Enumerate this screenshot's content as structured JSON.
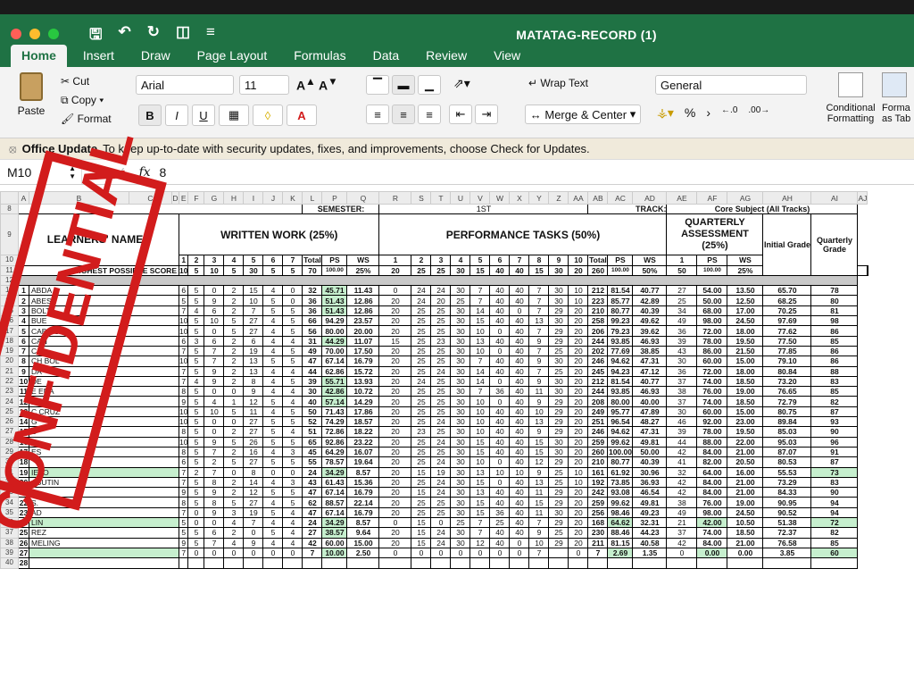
{
  "window": {
    "title": "MATATAG-RECORD (1)"
  },
  "tabs": [
    "Home",
    "Insert",
    "Draw",
    "Page Layout",
    "Formulas",
    "Data",
    "Review",
    "View"
  ],
  "ribbon": {
    "paste": "Paste",
    "cut": "Cut",
    "copy": "Copy",
    "format": "Format",
    "font": "Arial",
    "size": "11",
    "wrap": "Wrap Text",
    "merge": "Merge & Center",
    "numfmt": "General",
    "percent": "%",
    "cond1": "Conditional",
    "cond2": "Formatting",
    "fmt1": "Forma",
    "fmt2": "as Tab"
  },
  "notice": {
    "title": "Office Update",
    "text": "To keep up-to-date with security updates, fixes, and improvements, choose Check for Updates."
  },
  "formula": {
    "cell": "M10",
    "fx": "fx",
    "value": "8"
  },
  "stamp": "CONFIDENTIAL",
  "cols": [
    "A",
    "B",
    "C",
    "D",
    "E",
    "F",
    "G",
    "H",
    "I",
    "J",
    "K",
    "L",
    "P",
    "Q",
    "R",
    "S",
    "T",
    "U",
    "V",
    "W",
    "X",
    "Y",
    "Z",
    "AA",
    "AB",
    "AC",
    "AD",
    "AE",
    "AF",
    "AG",
    "AH",
    "AI",
    "AJ"
  ],
  "header": {
    "semester_label": "SEMESTER:",
    "semester": "1ST",
    "track_label": "TRACK:",
    "track": "Core Subject (All Tracks)",
    "names": "LEARNERS' NAMES",
    "ww": "WRITTEN WORK (25%)",
    "pt": "PERFORMANCE TASKS (50%)",
    "qa": "QUARTERLY ASSESSMENT (25%)",
    "initial": "Initial Grade",
    "quarterly": "Quarterly Grade",
    "hps": "HIGHEST POSSIBLE SCORE",
    "total": "Total",
    "ps": "PS",
    "ws": "WS"
  },
  "hps": {
    "ww": [
      "10",
      "5",
      "10",
      "5",
      "30",
      "5",
      "5",
      "70",
      "100.00",
      "25%"
    ],
    "pt": [
      "20",
      "25",
      "25",
      "30",
      "15",
      "40",
      "40",
      "15",
      "30",
      "20",
      "260",
      "100.00",
      "50%"
    ],
    "qa": [
      "50",
      "100.00",
      "25%"
    ]
  },
  "rows": [
    {
      "r": "13",
      "n": "1",
      "name": "ABDA",
      "ww": [
        "6",
        "5",
        "0",
        "2",
        "15",
        "4",
        "0",
        "32",
        "45.71",
        "11.43"
      ],
      "pt": [
        "0",
        "24",
        "24",
        "30",
        "7",
        "40",
        "40",
        "7",
        "30",
        "10",
        "212",
        "81.54",
        "40.77"
      ],
      "qa": [
        "27",
        "54.00",
        "13.50"
      ],
      "ig": "65.70",
      "qg": "78",
      "psg": 1
    },
    {
      "r": "14",
      "n": "2",
      "name": "ABES",
      "ww": [
        "5",
        "5",
        "9",
        "2",
        "10",
        "5",
        "0",
        "36",
        "51.43",
        "12.86"
      ],
      "pt": [
        "20",
        "24",
        "20",
        "25",
        "7",
        "40",
        "40",
        "7",
        "30",
        "10",
        "223",
        "85.77",
        "42.89"
      ],
      "qa": [
        "25",
        "50.00",
        "12.50"
      ],
      "ig": "68.25",
      "qg": "80",
      "psg": 1
    },
    {
      "r": "15",
      "n": "3",
      "name": "BOLT",
      "ww": [
        "7",
        "4",
        "6",
        "2",
        "7",
        "5",
        "5",
        "36",
        "51.43",
        "12.86"
      ],
      "pt": [
        "20",
        "25",
        "25",
        "30",
        "14",
        "40",
        "0",
        "7",
        "29",
        "20",
        "210",
        "80.77",
        "40.39"
      ],
      "qa": [
        "34",
        "68.00",
        "17.00"
      ],
      "ig": "70.25",
      "qg": "81",
      "psg": 1
    },
    {
      "r": "16",
      "n": "4",
      "name": "BUE",
      "ww": [
        "10",
        "5",
        "10",
        "5",
        "27",
        "4",
        "5",
        "66",
        "94.29",
        "23.57"
      ],
      "pt": [
        "20",
        "25",
        "25",
        "30",
        "15",
        "40",
        "40",
        "13",
        "30",
        "20",
        "258",
        "99.23",
        "49.62"
      ],
      "qa": [
        "49",
        "98.00",
        "24.50"
      ],
      "ig": "97.69",
      "qg": "98"
    },
    {
      "r": "17",
      "n": "5",
      "name": "CAB ES",
      "ww": [
        "10",
        "5",
        "0",
        "5",
        "27",
        "4",
        "5",
        "56",
        "80.00",
        "20.00"
      ],
      "pt": [
        "20",
        "25",
        "25",
        "30",
        "10",
        "0",
        "40",
        "7",
        "29",
        "20",
        "206",
        "79.23",
        "39.62"
      ],
      "qa": [
        "36",
        "72.00",
        "18.00"
      ],
      "ig": "77.62",
      "qg": "86"
    },
    {
      "r": "18",
      "n": "6",
      "name": "CAN",
      "ww": [
        "6",
        "3",
        "6",
        "2",
        "6",
        "4",
        "4",
        "31",
        "44.29",
        "11.07"
      ],
      "pt": [
        "15",
        "25",
        "23",
        "30",
        "13",
        "40",
        "40",
        "9",
        "29",
        "20",
        "244",
        "93.85",
        "46.93"
      ],
      "qa": [
        "39",
        "78.00",
        "19.50"
      ],
      "ig": "77.50",
      "qg": "85",
      "psg": 1
    },
    {
      "r": "19",
      "n": "7",
      "name": "CA",
      "ww": [
        "7",
        "5",
        "7",
        "2",
        "19",
        "4",
        "5",
        "49",
        "70.00",
        "17.50"
      ],
      "pt": [
        "20",
        "25",
        "25",
        "30",
        "10",
        "0",
        "40",
        "7",
        "25",
        "20",
        "202",
        "77.69",
        "38.85"
      ],
      "qa": [
        "43",
        "86.00",
        "21.50"
      ],
      "ig": "77.85",
      "qg": "86"
    },
    {
      "r": "20",
      "n": "8",
      "name": "CH BOL",
      "ww": [
        "10",
        "5",
        "7",
        "2",
        "13",
        "5",
        "5",
        "47",
        "67.14",
        "16.79"
      ],
      "pt": [
        "20",
        "25",
        "25",
        "30",
        "7",
        "40",
        "40",
        "9",
        "30",
        "20",
        "246",
        "94.62",
        "47.31"
      ],
      "qa": [
        "30",
        "60.00",
        "15.00"
      ],
      "ig": "79.10",
      "qg": "86"
    },
    {
      "r": "21",
      "n": "9",
      "name": "DA",
      "ww": [
        "7",
        "5",
        "9",
        "2",
        "13",
        "4",
        "4",
        "44",
        "62.86",
        "15.72"
      ],
      "pt": [
        "20",
        "25",
        "24",
        "30",
        "14",
        "40",
        "40",
        "7",
        "25",
        "20",
        "245",
        "94.23",
        "47.12"
      ],
      "qa": [
        "36",
        "72.00",
        "18.00"
      ],
      "ig": "80.84",
      "qg": "88"
    },
    {
      "r": "22",
      "n": "10",
      "name": "DE",
      "ww": [
        "7",
        "4",
        "9",
        "2",
        "8",
        "4",
        "5",
        "39",
        "55.71",
        "13.93"
      ],
      "pt": [
        "20",
        "24",
        "25",
        "30",
        "14",
        "0",
        "40",
        "9",
        "30",
        "20",
        "212",
        "81.54",
        "40.77"
      ],
      "qa": [
        "37",
        "74.00",
        "18.50"
      ],
      "ig": "73.20",
      "qg": "83",
      "psg": 1
    },
    {
      "r": "23",
      "n": "11",
      "name": "E ENA",
      "ww": [
        "8",
        "5",
        "0",
        "0",
        "9",
        "4",
        "4",
        "30",
        "42.86",
        "10.72"
      ],
      "pt": [
        "20",
        "25",
        "25",
        "30",
        "7",
        "36",
        "40",
        "11",
        "30",
        "20",
        "244",
        "93.85",
        "46.93"
      ],
      "qa": [
        "38",
        "76.00",
        "19.00"
      ],
      "ig": "76.65",
      "qg": "85",
      "psg": 1
    },
    {
      "r": "24",
      "n": "12",
      "name": "F",
      "ww": [
        "9",
        "5",
        "4",
        "1",
        "12",
        "5",
        "4",
        "40",
        "57.14",
        "14.29"
      ],
      "pt": [
        "20",
        "25",
        "25",
        "30",
        "10",
        "0",
        "40",
        "9",
        "29",
        "20",
        "208",
        "80.00",
        "40.00"
      ],
      "qa": [
        "37",
        "74.00",
        "18.50"
      ],
      "ig": "72.79",
      "qg": "82",
      "psg": 1
    },
    {
      "r": "25",
      "n": "13",
      "name": "C CRUZ",
      "ww": [
        "10",
        "5",
        "10",
        "5",
        "11",
        "4",
        "5",
        "50",
        "71.43",
        "17.86"
      ],
      "pt": [
        "20",
        "25",
        "25",
        "30",
        "10",
        "40",
        "40",
        "10",
        "29",
        "20",
        "249",
        "95.77",
        "47.89"
      ],
      "qa": [
        "30",
        "60.00",
        "15.00"
      ],
      "ig": "80.75",
      "qg": "87"
    },
    {
      "r": "26",
      "n": "14",
      "name": "G",
      "ww": [
        "10",
        "5",
        "0",
        "0",
        "27",
        "5",
        "5",
        "52",
        "74.29",
        "18.57"
      ],
      "pt": [
        "20",
        "25",
        "24",
        "30",
        "10",
        "40",
        "40",
        "13",
        "29",
        "20",
        "251",
        "96.54",
        "48.27"
      ],
      "qa": [
        "46",
        "92.00",
        "23.00"
      ],
      "ig": "89.84",
      "qg": "93"
    },
    {
      "r": "27",
      "n": "15",
      "name": "C",
      "ww": [
        "8",
        "5",
        "0",
        "2",
        "27",
        "5",
        "4",
        "51",
        "72.86",
        "18.22"
      ],
      "pt": [
        "20",
        "23",
        "25",
        "30",
        "10",
        "40",
        "40",
        "9",
        "29",
        "20",
        "246",
        "94.62",
        "47.31"
      ],
      "qa": [
        "39",
        "78.00",
        "19.50"
      ],
      "ig": "85.03",
      "qg": "90"
    },
    {
      "r": "28",
      "n": "16",
      "name": "",
      "ww": [
        "10",
        "5",
        "9",
        "5",
        "26",
        "5",
        "5",
        "65",
        "92.86",
        "23.22"
      ],
      "pt": [
        "20",
        "25",
        "24",
        "30",
        "15",
        "40",
        "40",
        "15",
        "30",
        "20",
        "259",
        "99.62",
        "49.81"
      ],
      "qa": [
        "44",
        "88.00",
        "22.00"
      ],
      "ig": "95.03",
      "qg": "96"
    },
    {
      "r": "29",
      "n": "17",
      "name": "ES",
      "ww": [
        "8",
        "5",
        "7",
        "2",
        "16",
        "4",
        "3",
        "45",
        "64.29",
        "16.07"
      ],
      "pt": [
        "20",
        "25",
        "25",
        "30",
        "15",
        "40",
        "40",
        "15",
        "30",
        "20",
        "260",
        "100.00",
        "50.00"
      ],
      "qa": [
        "42",
        "84.00",
        "21.00"
      ],
      "ig": "87.07",
      "qg": "91"
    },
    {
      "r": "30",
      "n": "18",
      "name": "",
      "ww": [
        "6",
        "5",
        "2",
        "5",
        "27",
        "5",
        "5",
        "55",
        "78.57",
        "19.64"
      ],
      "pt": [
        "20",
        "25",
        "24",
        "30",
        "10",
        "0",
        "40",
        "12",
        "29",
        "20",
        "210",
        "80.77",
        "40.39"
      ],
      "qa": [
        "41",
        "82.00",
        "20.50"
      ],
      "ig": "80.53",
      "qg": "87"
    },
    {
      "r": "31",
      "n": "19",
      "name": "IETO",
      "ww": [
        "7",
        "2",
        "7",
        "0",
        "8",
        "0",
        "0",
        "24",
        "34.29",
        "8.57"
      ],
      "pt": [
        "20",
        "15",
        "19",
        "30",
        "13",
        "10",
        "10",
        "9",
        "25",
        "10",
        "161",
        "61.92",
        "30.96"
      ],
      "qa": [
        "32",
        "64.00",
        "16.00"
      ],
      "ig": "55.53",
      "qg": "73",
      "hl": 1,
      "psg": 1
    },
    {
      "r": "32",
      "n": "20",
      "name": "ABUTIN",
      "ww": [
        "7",
        "5",
        "8",
        "2",
        "14",
        "4",
        "3",
        "43",
        "61.43",
        "15.36"
      ],
      "pt": [
        "20",
        "25",
        "24",
        "30",
        "15",
        "0",
        "40",
        "13",
        "25",
        "10",
        "192",
        "73.85",
        "36.93"
      ],
      "qa": [
        "42",
        "84.00",
        "21.00"
      ],
      "ig": "73.29",
      "qg": "83"
    },
    {
      "r": "33",
      "n": "21",
      "name": "",
      "ww": [
        "9",
        "5",
        "9",
        "2",
        "12",
        "5",
        "5",
        "47",
        "67.14",
        "16.79"
      ],
      "pt": [
        "20",
        "15",
        "24",
        "30",
        "13",
        "40",
        "40",
        "11",
        "29",
        "20",
        "242",
        "93.08",
        "46.54"
      ],
      "qa": [
        "42",
        "84.00",
        "21.00"
      ],
      "ig": "84.33",
      "qg": "90"
    },
    {
      "r": "34",
      "n": "22",
      "name": "S.",
      "ww": [
        "8",
        "5",
        "8",
        "5",
        "27",
        "4",
        "5",
        "62",
        "88.57",
        "22.14"
      ],
      "pt": [
        "20",
        "25",
        "25",
        "30",
        "15",
        "40",
        "40",
        "15",
        "29",
        "20",
        "259",
        "99.62",
        "49.81"
      ],
      "qa": [
        "38",
        "76.00",
        "19.00"
      ],
      "ig": "90.95",
      "qg": "94"
    },
    {
      "r": "35",
      "n": "23",
      "name": "AD",
      "ww": [
        "7",
        "0",
        "9",
        "3",
        "19",
        "5",
        "4",
        "47",
        "67.14",
        "16.79"
      ],
      "pt": [
        "20",
        "25",
        "25",
        "30",
        "15",
        "36",
        "40",
        "11",
        "30",
        "20",
        "256",
        "98.46",
        "49.23"
      ],
      "qa": [
        "49",
        "98.00",
        "24.50"
      ],
      "ig": "90.52",
      "qg": "94"
    },
    {
      "r": "36",
      "n": "24",
      "name": "LIN",
      "ww": [
        "5",
        "0",
        "0",
        "4",
        "7",
        "4",
        "4",
        "24",
        "34.29",
        "8.57"
      ],
      "pt": [
        "0",
        "15",
        "0",
        "25",
        "7",
        "25",
        "40",
        "7",
        "29",
        "20",
        "168",
        "64.62",
        "32.31"
      ],
      "qa": [
        "21",
        "42.00",
        "10.50"
      ],
      "ig": "51.38",
      "qg": "72",
      "hl": 1,
      "psg": 1,
      "qsg": 1
    },
    {
      "r": "37",
      "n": "25",
      "name": "REZ",
      "ww": [
        "5",
        "5",
        "6",
        "2",
        "0",
        "5",
        "4",
        "27",
        "38.57",
        "9.64"
      ],
      "pt": [
        "20",
        "15",
        "24",
        "30",
        "7",
        "40",
        "40",
        "9",
        "25",
        "20",
        "230",
        "88.46",
        "44.23"
      ],
      "qa": [
        "37",
        "74.00",
        "18.50"
      ],
      "ig": "72.37",
      "qg": "82",
      "psg": 1
    },
    {
      "r": "38",
      "n": "26",
      "name": "MELING",
      "ww": [
        "9",
        "5",
        "7",
        "4",
        "9",
        "4",
        "4",
        "42",
        "60.00",
        "15.00"
      ],
      "pt": [
        "20",
        "15",
        "24",
        "30",
        "12",
        "40",
        "0",
        "10",
        "29",
        "20",
        "211",
        "81.15",
        "40.58"
      ],
      "qa": [
        "42",
        "84.00",
        "21.00"
      ],
      "ig": "76.58",
      "qg": "85"
    },
    {
      "r": "39",
      "n": "27",
      "name": "",
      "ww": [
        "7",
        "0",
        "0",
        "0",
        "0",
        "0",
        "0",
        "7",
        "10.00",
        "2.50"
      ],
      "pt": [
        "0",
        "0",
        "0",
        "0",
        "0",
        "0",
        "0",
        "7",
        "",
        "0",
        "7",
        "2.69",
        "1.35"
      ],
      "qa": [
        "0",
        "0.00",
        "0.00"
      ],
      "ig": "3.85",
      "qg": "60",
      "hl": 1,
      "psg": 1,
      "qsg": 1
    },
    {
      "r": "40",
      "n": "28",
      "name": "",
      "ww": [
        "",
        "",
        "",
        "",
        "",
        "",
        "",
        "",
        "",
        ""
      ],
      "pt": [
        "",
        "",
        "",
        "",
        "",
        "",
        "",
        "",
        "",
        "",
        "",
        "",
        ""
      ],
      "qa": [
        "",
        "",
        ""
      ],
      "ig": "",
      "qg": ""
    }
  ]
}
